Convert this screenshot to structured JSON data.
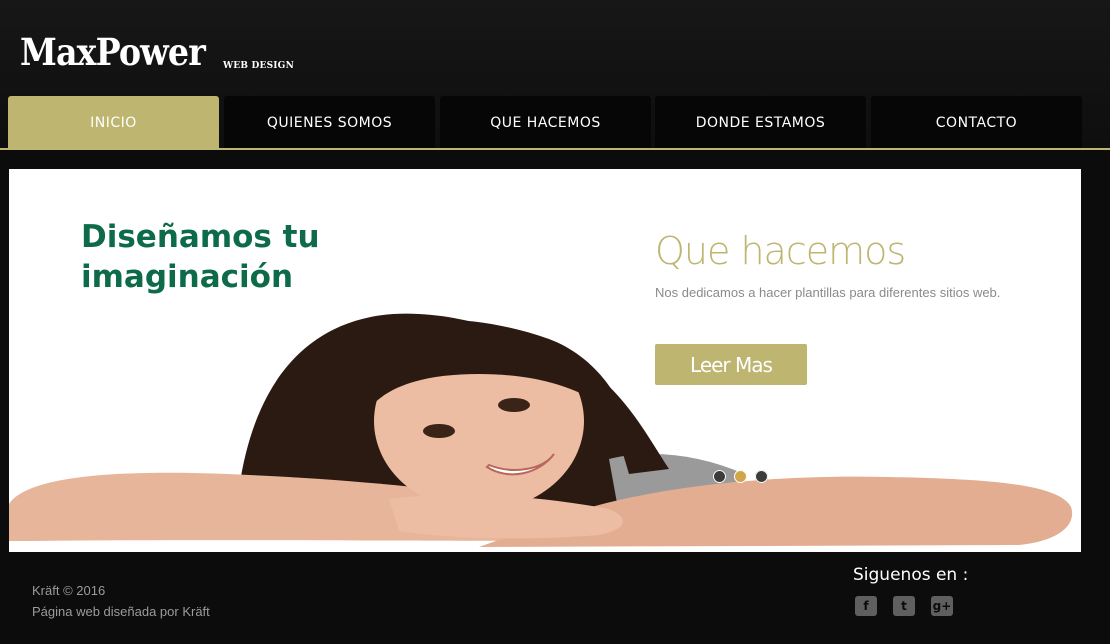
{
  "brand": {
    "name": "MaxPower",
    "tagline": "WEB DESIGN"
  },
  "nav": {
    "items": [
      {
        "label": "INICIO",
        "active": true
      },
      {
        "label": "QUIENES SOMOS",
        "active": false
      },
      {
        "label": "QUE HACEMOS",
        "active": false
      },
      {
        "label": "DONDE ESTAMOS",
        "active": false
      },
      {
        "label": "CONTACTO",
        "active": false
      }
    ]
  },
  "hero": {
    "headline": "Diseñamos tu imaginación",
    "section_title": "Que hacemos",
    "description": "Nos dedicamos a hacer plantillas para diferentes sitios web.",
    "cta_label": "Leer Mas",
    "slider": {
      "count": 3,
      "active_index": 1
    }
  },
  "footer": {
    "copyright": "Kräft © 2016",
    "credit": "Página web diseñada por Kräft",
    "follow_label": "Siguenos en :",
    "social": [
      {
        "icon": "facebook-icon",
        "glyph": "f"
      },
      {
        "icon": "twitter-icon",
        "glyph": "t"
      },
      {
        "icon": "google-plus-icon",
        "glyph": "g+"
      }
    ]
  },
  "colors": {
    "accent": "#bdb570",
    "headline": "#0d6b4a",
    "background": "#0c0c0c"
  }
}
